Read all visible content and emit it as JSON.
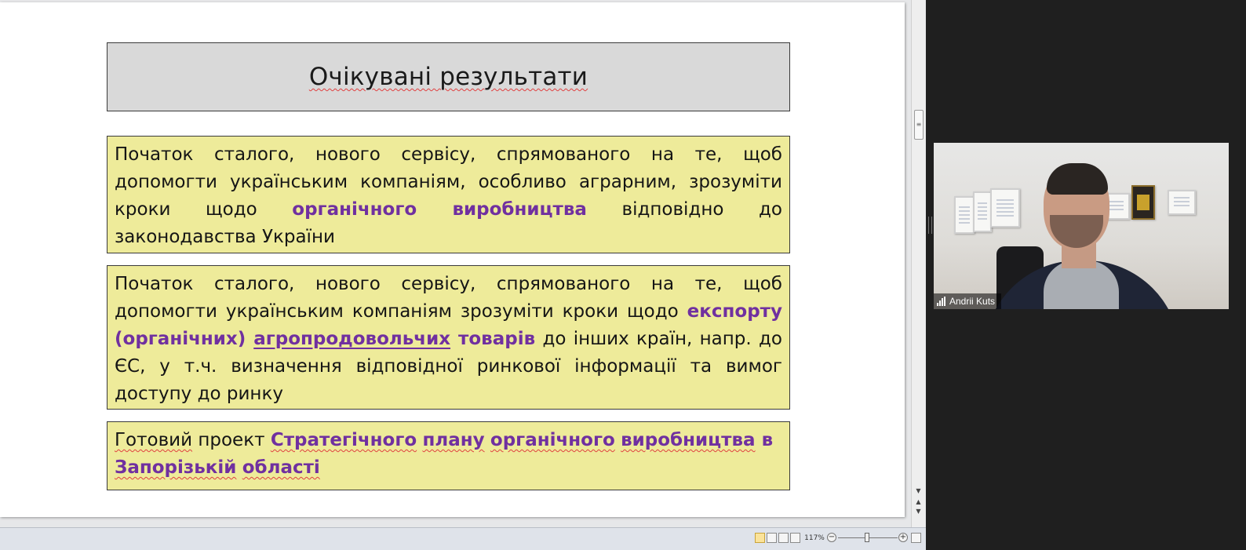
{
  "slide": {
    "title": "Очікувані результати",
    "box1": {
      "p1": "Початок сталого, нового сервісу, спрямованого на те, щоб допомогти українським компаніям, особливо аграрним, зрозуміти кроки щодо ",
      "h1": "органічного виробництва",
      "p2": " відповідно до законодавства України"
    },
    "box2": {
      "p1": "Початок сталого, нового сервісу, спрямованого на те, щоб допомогти українським компаніям зрозуміти кроки щодо ",
      "h1": "експорту (органічних) ",
      "h2": "агропродовольчих",
      "h3": " товарів",
      "p2": " до інших країн, напр. до ЄС, у т.ч. визначення відповідної ринкової інформації та вимог доступу до ринку"
    },
    "box3": {
      "w1": "Готовий",
      "w2": " проект ",
      "h1": "Стратегічного",
      "h2": "плану",
      "h3": "органічного",
      "h4": "виробництва",
      "h5": " в ",
      "h6": "Запорізькій",
      "h7": "області"
    }
  },
  "statusbar": {
    "zoom_level": "117%",
    "zoom_out": "−",
    "zoom_in": "+"
  },
  "video": {
    "participant_name": "Andrii Kuts",
    "signal_icon": "signal-strength-icon"
  },
  "colors": {
    "highlight_purple": "#7030a0",
    "box_yellow": "#eeeb9a",
    "title_gray": "#d9d9d9",
    "background_dark": "#1f1f1f"
  }
}
